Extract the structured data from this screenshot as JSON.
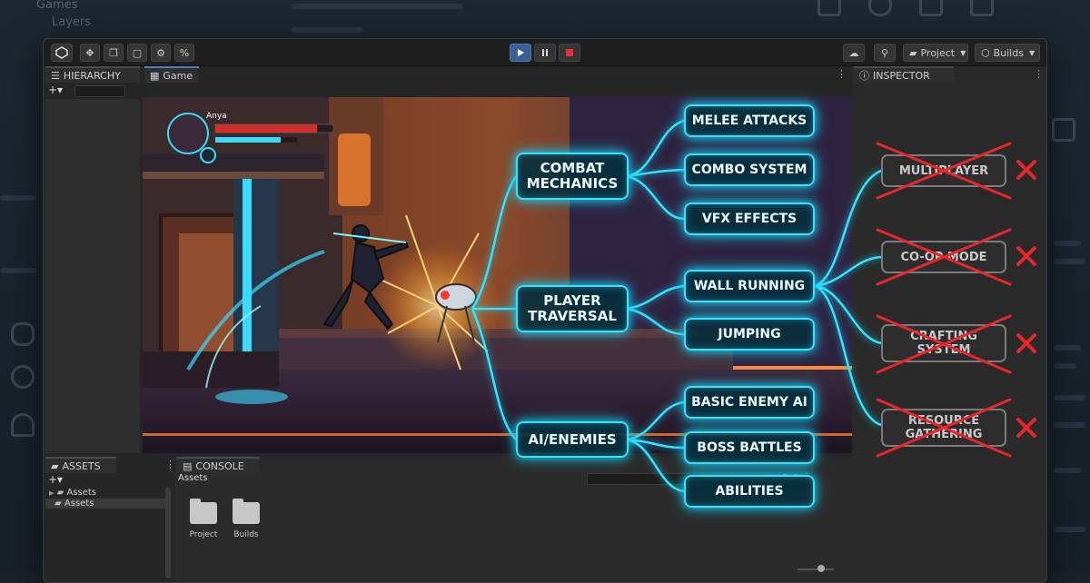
{
  "background": {
    "left_labels": [
      "Games",
      "Layers"
    ]
  },
  "toolbar": {
    "project_label": "Project",
    "builds_label": "Builds"
  },
  "hierarchy": {
    "tab_label": "HIERARCHY"
  },
  "game": {
    "tab_label": "Game",
    "player_name": "Anya"
  },
  "inspector": {
    "tab_label": "INSPECTOR"
  },
  "assets_panel": {
    "tab_label": "ASSETS",
    "tree_items": [
      "Assets",
      "Assets"
    ]
  },
  "console": {
    "tab_label": "CONSOLE",
    "breadcrumb": "Assets",
    "folders": [
      "Project",
      "Builds"
    ]
  },
  "mindmap": {
    "branches": [
      {
        "label_line1": "COMBAT",
        "label_line2": "MECHANICS",
        "children": [
          "MELEE ATTACKS",
          "COMBO SYSTEM",
          "VFX EFFECTS"
        ]
      },
      {
        "label_line1": "PLAYER",
        "label_line2": "TRAVERSAL",
        "children": [
          "WALL RUNNING",
          "JUMPING"
        ]
      },
      {
        "label_line1": "AI/ENEMIES",
        "label_line2": "",
        "children": [
          "BASIC ENEMY AI",
          "BOSS BATTLES",
          "ABILITIES"
        ]
      }
    ],
    "cut_features": [
      {
        "line1": "MULTIPLAYER",
        "line2": ""
      },
      {
        "line1": "CO-OP MODE",
        "line2": ""
      },
      {
        "line1": "CRAFTING",
        "line2": "SYSTEM"
      },
      {
        "line1": "RESOURCE",
        "line2": "GATHERING"
      }
    ]
  },
  "colors": {
    "accent_cyan": "#36e2ff",
    "cut_red": "#e8262b",
    "play_blue": "#3a5f96"
  }
}
